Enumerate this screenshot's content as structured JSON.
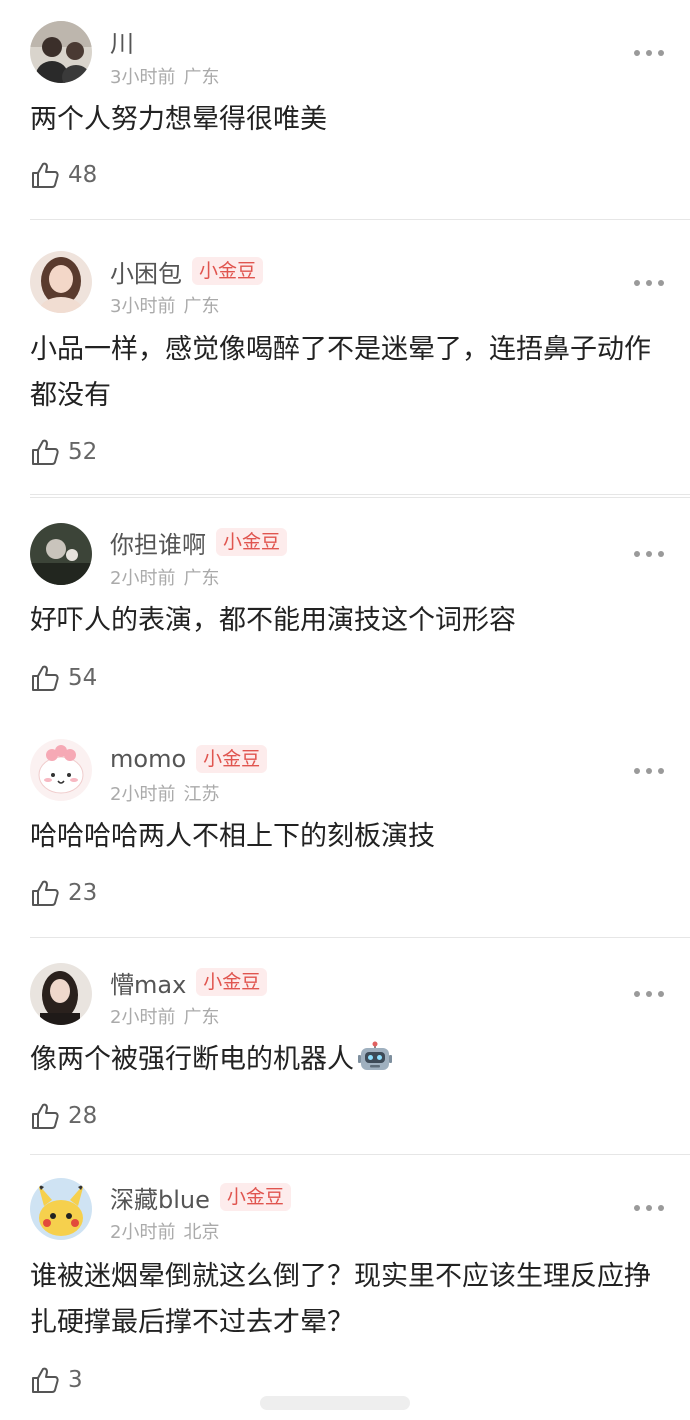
{
  "comments": [
    {
      "username": "川",
      "badge": "",
      "time": "3小时前",
      "location": "广东",
      "text": "两个人努力想晕得很唯美",
      "likes": "48"
    },
    {
      "username": "小困包",
      "badge": "小金豆",
      "time": "3小时前",
      "location": "广东",
      "text": "小品一样，感觉像喝醉了不是迷晕了，连捂鼻子动作都没有",
      "likes": "52"
    },
    {
      "username": "你担谁啊",
      "badge": "小金豆",
      "time": "2小时前",
      "location": "广东",
      "text": "好吓人的表演，都不能用演技这个词形容",
      "likes": "54"
    },
    {
      "username": "momo",
      "badge": "小金豆",
      "time": "2小时前",
      "location": "江苏",
      "text": "哈哈哈哈两人不相上下的刻板演技",
      "likes": "23"
    },
    {
      "username": "懵max",
      "badge": "小金豆",
      "time": "2小时前",
      "location": "广东",
      "text": "像两个被强行断电的机器人",
      "emoji": "robot-emoji",
      "likes": "28"
    },
    {
      "username": "深藏blue",
      "badge": "小金豆",
      "time": "2小时前",
      "location": "北京",
      "text": "谁被迷烟晕倒就这么倒了？现实里不应该生理反应挣扎硬撑最后撑不过去才晕？",
      "likes": "3"
    }
  ],
  "icons": {
    "like": "thumbs-up-icon",
    "more": "more-dots-icon"
  },
  "colors": {
    "badge_text": "#e0554f",
    "badge_bg": "#fdecec",
    "meta": "#aaaaaa",
    "divider": "#e6e6e6"
  }
}
